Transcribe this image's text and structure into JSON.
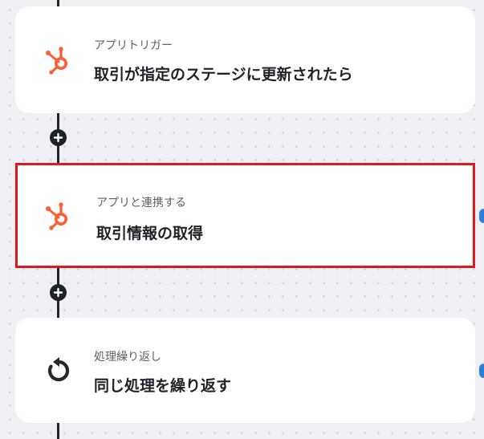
{
  "flow": {
    "steps": [
      {
        "label": "アプリトリガー",
        "title": "取引が指定のステージに更新されたら",
        "icon": "hubspot-icon",
        "highlighted": false
      },
      {
        "label": "アプリと連携する",
        "title": "取引情報の取得",
        "icon": "hubspot-icon",
        "highlighted": true
      },
      {
        "label": "処理繰り返し",
        "title": "同じ処理を繰り返す",
        "icon": "loop-icon",
        "highlighted": false
      }
    ],
    "add_button_icon": "plus-icon"
  },
  "colors": {
    "hubspot_orange": "#ff5c35",
    "highlight_border": "#e0171d",
    "connector": "#22252b",
    "edge_handle": "#2f7de0"
  }
}
